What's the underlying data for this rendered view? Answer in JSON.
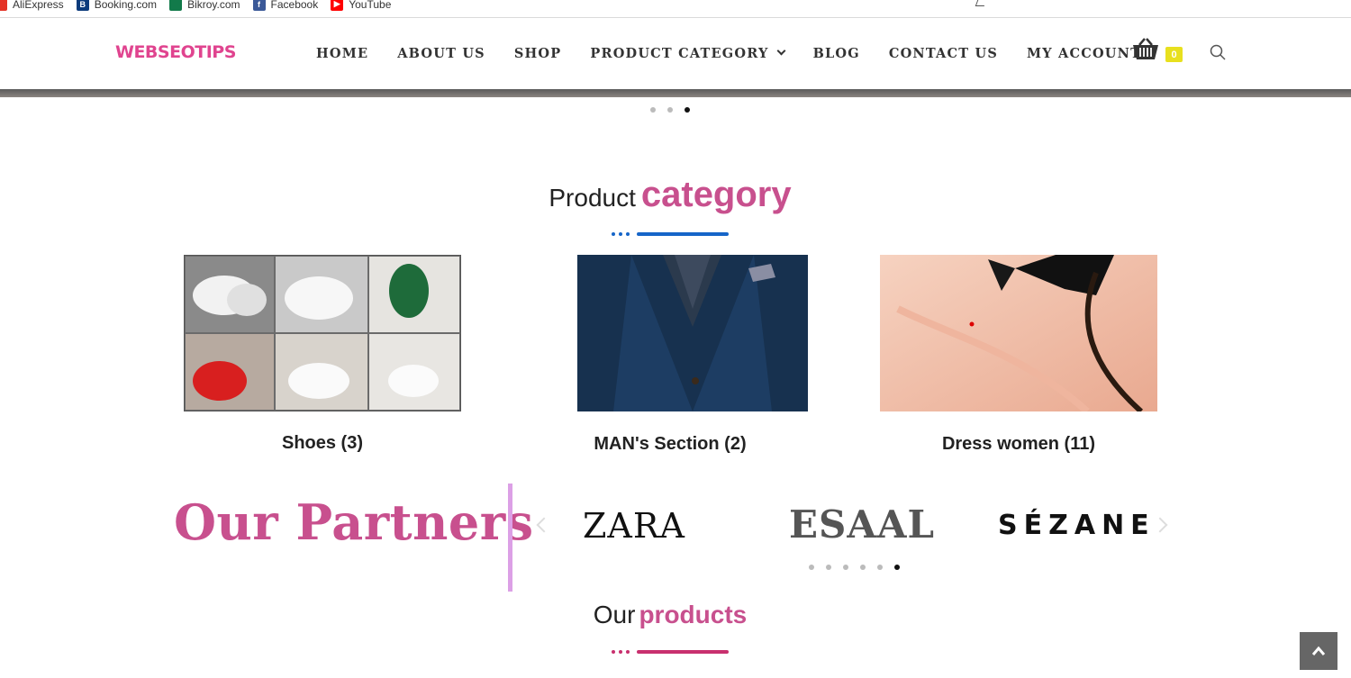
{
  "bookmarks": [
    {
      "label": "AliExpress",
      "icon": "aliexpress-icon"
    },
    {
      "label": "Booking.com",
      "icon": "booking-icon"
    },
    {
      "label": "Bikroy.com",
      "icon": "bikroy-icon"
    },
    {
      "label": "Facebook",
      "icon": "facebook-icon"
    },
    {
      "label": "YouTube",
      "icon": "youtube-icon"
    }
  ],
  "header": {
    "logo": "WEBSEOTIPS",
    "nav": [
      "HOME",
      "ABOUT US",
      "SHOP",
      "PRODUCT CATEGORY",
      "BLOG",
      "CONTACT US",
      "MY ACCOUNT"
    ],
    "cart_count": "0"
  },
  "category_section": {
    "title_plain": "Product",
    "title_accent": "category",
    "categories": [
      {
        "label": "Shoes (3)"
      },
      {
        "label": "MAN's Section (2)"
      },
      {
        "label": "Dress women (11)"
      }
    ]
  },
  "partners": {
    "title": "Our Partners",
    "brands": [
      "ZARA",
      "ESAAL",
      "SÉZANE"
    ]
  },
  "products_section": {
    "title_plain": "Our",
    "title_accent": "products"
  },
  "colors": {
    "accent_pink": "#c8508e",
    "logo_pink": "#e0448f",
    "divider_blue": "#1665c8",
    "divider_pink": "#c8306e",
    "cart_badge": "#e8e01e"
  }
}
